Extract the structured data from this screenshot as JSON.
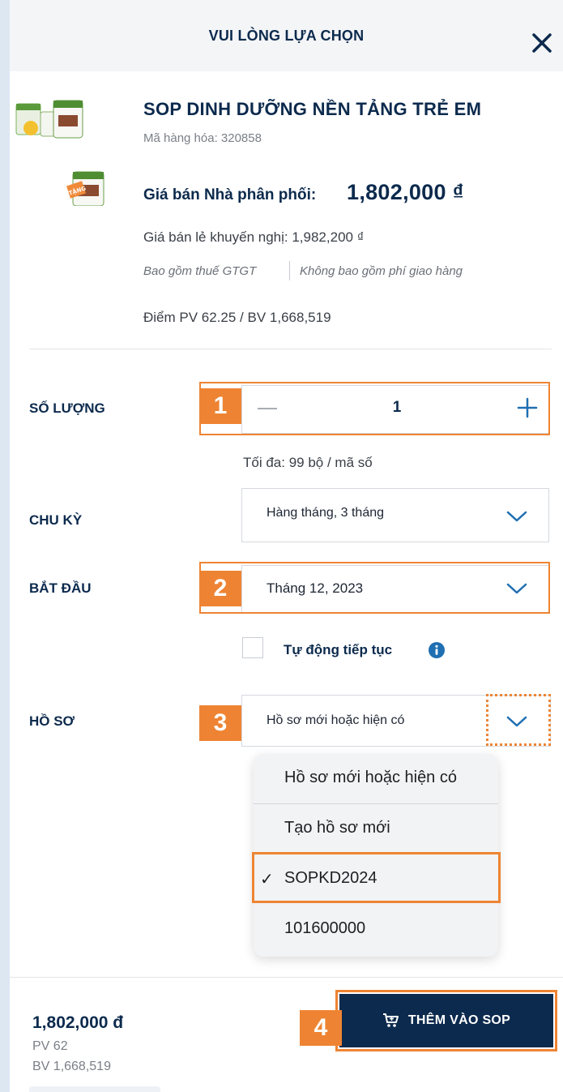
{
  "header": {
    "title": "VUI LÒNG LỰA CHỌN"
  },
  "product": {
    "title": "SOP DINH DƯỠNG NỀN TẢNG TRẺ EM",
    "sku": "Mã hàng hóa: 320858",
    "distributor_price_label": "Giá bán Nhà phân phối:",
    "distributor_price": "1,802,000 ₫",
    "retail_price": "Giá bán lẻ khuyến nghị: 1,982,200 ₫",
    "tax_note": "Bao gồm thuế GTGT",
    "shipping_note": "Không bao gồm phí giao hàng",
    "points": "Điểm PV 62.25 / BV 1,668,519",
    "gift_badge": "TẶNG"
  },
  "quantity": {
    "label": "SỐ LƯỢNG",
    "value": "1",
    "max_note": "Tối đa: 99 bộ / mã số"
  },
  "cycle": {
    "label": "CHU KỲ",
    "value": "Hàng tháng, 3 tháng"
  },
  "start": {
    "label": "BẮT ĐẦU",
    "value": "Tháng 12, 2023"
  },
  "auto_renew": {
    "label": "Tự động tiếp tục",
    "checked": false
  },
  "profile": {
    "label": "HỒ SƠ",
    "value": "Hồ sơ mới hoặc hiện có",
    "options": [
      "Hồ sơ mới hoặc hiện có",
      "Tạo hồ sơ mới",
      "SOPKD2024",
      "101600000"
    ],
    "selected_mark": "✓"
  },
  "footer": {
    "total_price": "1,802,000 đ",
    "pv": "PV 62",
    "bv": "BV 1,668,519",
    "add_button": "THÊM VÀO SOP"
  },
  "step_badges": [
    "1",
    "2",
    "3",
    "4"
  ],
  "colors": {
    "navy": "#0c2a4d",
    "accent_orange": "#ee8433",
    "link_blue": "#1f6fb2"
  },
  "icons": [
    "close-icon",
    "minus-icon",
    "plus-icon",
    "chevron-down-icon",
    "info-icon",
    "cart-icon",
    "checkmark-icon"
  ]
}
